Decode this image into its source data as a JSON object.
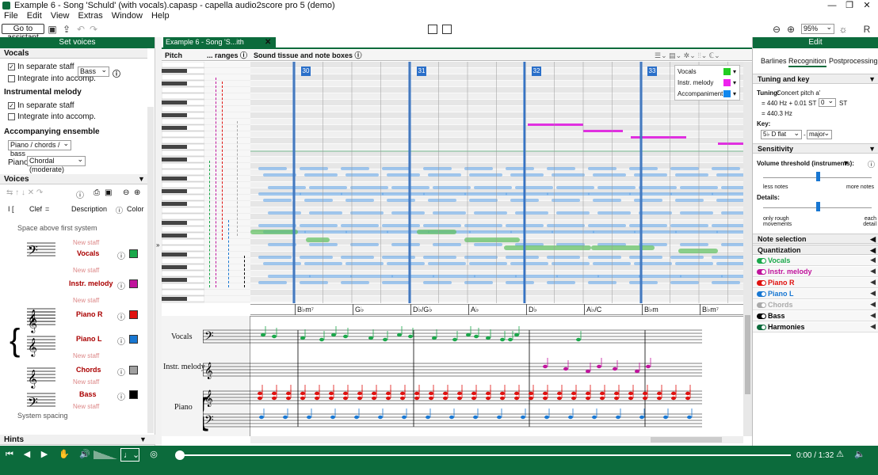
{
  "window": {
    "title": "Example 6 - Song 'Schuld' (with vocals).capasp - capella audio2score pro 5 (demo)",
    "controls": [
      "—",
      "❐",
      "✕"
    ]
  },
  "menu": [
    "File",
    "Edit",
    "View",
    "Extras",
    "Window",
    "Help"
  ],
  "toolbar": {
    "assistant_label": "Go to assistant",
    "zoom_value": "95%",
    "r_label": "R"
  },
  "left_panel": {
    "header": "Set voices",
    "vocals_section": "Vocals",
    "vocals_opt1": "In separate staff",
    "vocals_opt2": "Integrate into accomp.",
    "vocals_select": "Bass",
    "instr_section": "Instrumental melody",
    "instr_opt1": "In separate staff",
    "instr_opt2": "Integrate into accomp.",
    "accomp_section": "Accompanying ensemble",
    "accomp_select": "Piano / chords / bass",
    "piano_label": "Piano:",
    "piano_select": "Chordal (moderate)",
    "voices_section": "Voices",
    "col_clef": "Clef",
    "col_eq": "=",
    "col_desc": "Description",
    "col_color": "Color",
    "space_above": "Space above first system",
    "new_staff": "New staff",
    "voices": [
      {
        "name": "Vocals",
        "color": "#1aa84a"
      },
      {
        "name": "Instr. melody",
        "color": "#c0139c"
      },
      {
        "name": "Piano R",
        "color": "#e0110f"
      },
      {
        "name": "Piano L",
        "color": "#1877d2"
      },
      {
        "name": "Chords",
        "color": "#a0a0a0"
      },
      {
        "name": "Bass",
        "color": "#000000"
      }
    ],
    "system_spacing": "System spacing",
    "hints": "Hints"
  },
  "document": {
    "tab_label": "Example 6 - Song 'S...ith vocals).capasp",
    "col_pitch": "Pitch",
    "col_ranges": "... ranges",
    "col_sound": "Sound tissue and note boxes",
    "measures": [
      "30",
      "31",
      "32",
      "33"
    ],
    "legend": [
      {
        "name": "Vocals",
        "color": "#22cc22"
      },
      {
        "name": "Instr. melody",
        "color": "#ee22ee"
      },
      {
        "name": "Accompaniment",
        "color": "#1188ee"
      }
    ],
    "chords": [
      "B♭m⁷",
      "G♭",
      "D♭/G♭",
      "A♭",
      "D♭",
      "A♭/C",
      "B♭m",
      "B♭m⁷"
    ],
    "staff_labels": [
      "Vocals",
      "Instr. melody",
      "Piano"
    ]
  },
  "right_panel": {
    "header": "Edit",
    "tabs": [
      "Barlines",
      "Recognition",
      "Postprocessing"
    ],
    "tuning_section": "Tuning and key",
    "tuning_label": "Tuning:",
    "tuning_value": "Concert pitch a'",
    "hz_line": "= 440 Hz + 0.01 ST +",
    "st_value": "0",
    "st_unit": "ST",
    "hz_result": "= 440.3 Hz",
    "key_label": "Key:",
    "key_value": "5♭ D flat",
    "mode_value": "major",
    "sensitivity_section": "Sensitivity",
    "volume_label": "Volume threshold (instruments):",
    "less_notes": "less notes",
    "more_notes": "more notes",
    "details_label": "Details:",
    "only_rough": "only rough movements",
    "each_detail": "each detail",
    "note_selection": "Note selection",
    "quantization": "Quantization",
    "toggles": [
      {
        "name": "Vocals",
        "color": "#1aa84a"
      },
      {
        "name": "Instr. melody",
        "color": "#c0139c"
      },
      {
        "name": "Piano R",
        "color": "#e0110f"
      },
      {
        "name": "Piano L",
        "color": "#1877d2"
      },
      {
        "name": "Chords",
        "color": "#aaaaaa"
      },
      {
        "name": "Bass",
        "color": "#000000"
      },
      {
        "name": "Harmonies",
        "color": "#0c6b3c"
      }
    ]
  },
  "status": {
    "time": "0:00 / 1:32"
  }
}
